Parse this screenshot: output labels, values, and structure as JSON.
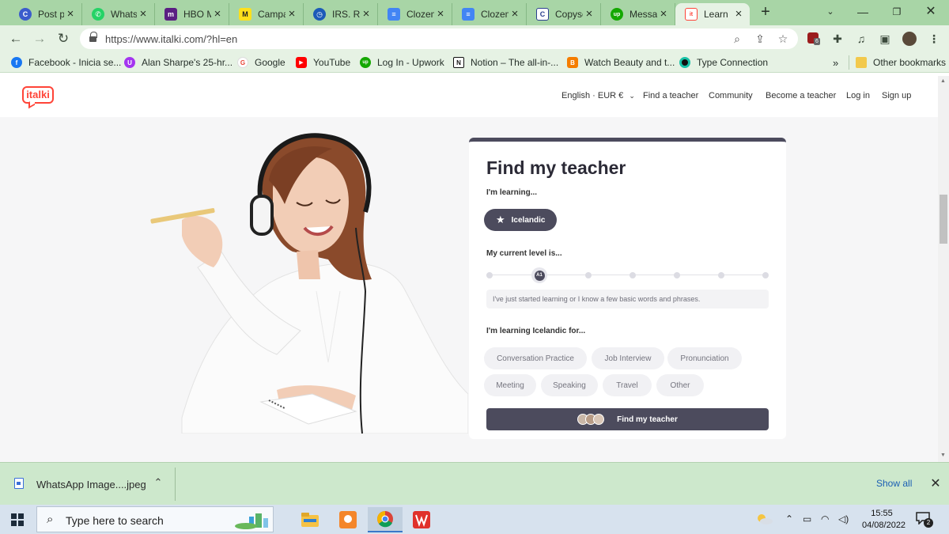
{
  "browser": {
    "tabs": [
      {
        "title": "Post pa",
        "icon": "c-logo-icon",
        "color": "#3b5ccc",
        "glyph": "C"
      },
      {
        "title": "Whatsa",
        "icon": "whatsapp-icon",
        "color": "#25d366",
        "glyph": "✆"
      },
      {
        "title": "HBO M",
        "icon": "hbo-max-icon",
        "color": "#5a1f82",
        "glyph": "m"
      },
      {
        "title": "Campa",
        "icon": "mailchimp-icon",
        "color": "#ffe01b",
        "glyph": "M"
      },
      {
        "title": "IRS. Re",
        "icon": "clock-icon",
        "color": "#1c5bb8",
        "glyph": "◷"
      },
      {
        "title": "Clozem",
        "icon": "google-docs-icon",
        "color": "#4285f4",
        "glyph": "≡"
      },
      {
        "title": "Clozem",
        "icon": "google-docs-icon",
        "color": "#4285f4",
        "glyph": "≡"
      },
      {
        "title": "Copysc",
        "icon": "copyscape-icon",
        "color": "#2a3f8f",
        "glyph": "C"
      },
      {
        "title": "Messa",
        "icon": "upwork-icon",
        "color": "#14a800",
        "glyph": "up"
      },
      {
        "title": "Learn ",
        "icon": "italki-icon",
        "color": "#ff4438",
        "glyph": "it"
      }
    ],
    "url": "https://www.italki.com/?hl=en",
    "bookmarks": [
      {
        "label": "Facebook - Inicia se...",
        "icon": "facebook-icon",
        "color": "#1877f2",
        "glyph": "f"
      },
      {
        "label": "Alan Sharpe's 25-hr...",
        "icon": "udemy-icon",
        "color": "#a435f0",
        "glyph": "U"
      },
      {
        "label": "Google",
        "icon": "google-icon",
        "color": "#ea4335",
        "glyph": "G"
      },
      {
        "label": "YouTube",
        "icon": "youtube-icon",
        "color": "#ff0000",
        "glyph": "▶"
      },
      {
        "label": "Log In - Upwork",
        "icon": "upwork-icon",
        "color": "#14a800",
        "glyph": "up"
      },
      {
        "label": "Notion – The all-in-...",
        "icon": "notion-icon",
        "color": "#111111",
        "glyph": "N"
      },
      {
        "label": "Watch Beauty and t...",
        "icon": "blogger-icon",
        "color": "#f57d00",
        "glyph": "B"
      },
      {
        "label": "Type Connection",
        "icon": "type-connection-icon",
        "color": "#0f8f7f",
        "glyph": "●"
      }
    ],
    "bookmarks_overflow": "»",
    "other_bookmarks": "Other bookmarks",
    "extension_badge": "6"
  },
  "site": {
    "logo": "italki",
    "brand_color": "#ff4438",
    "nav": {
      "language_currency": "English · EUR €",
      "find_teacher": "Find a teacher",
      "community": "Community",
      "become_teacher": "Become a teacher",
      "login": "Log in",
      "signup": "Sign up"
    },
    "card": {
      "title": "Find my teacher",
      "learning_label": "I'm learning...",
      "language": "Icelandic",
      "level_label": "My current level is...",
      "level_selected": "A1",
      "level_steps": 7,
      "level_selected_index": 1,
      "level_description": "I've just started learning or I know a few basic words and phrases.",
      "purpose_label": "I'm learning Icelandic for...",
      "purposes": [
        "Conversation Practice",
        "Job Interview",
        "Pronunciation",
        "Meeting",
        "Speaking",
        "Travel",
        "Other"
      ],
      "cta": "Find my teacher",
      "accent_color": "#4c4b5d"
    }
  },
  "download": {
    "filename": "WhatsApp Image....jpeg",
    "show_all": "Show all"
  },
  "taskbar": {
    "search_placeholder": "Type here to search",
    "time": "15:55",
    "date": "04/08/2022",
    "notifications": "2"
  }
}
